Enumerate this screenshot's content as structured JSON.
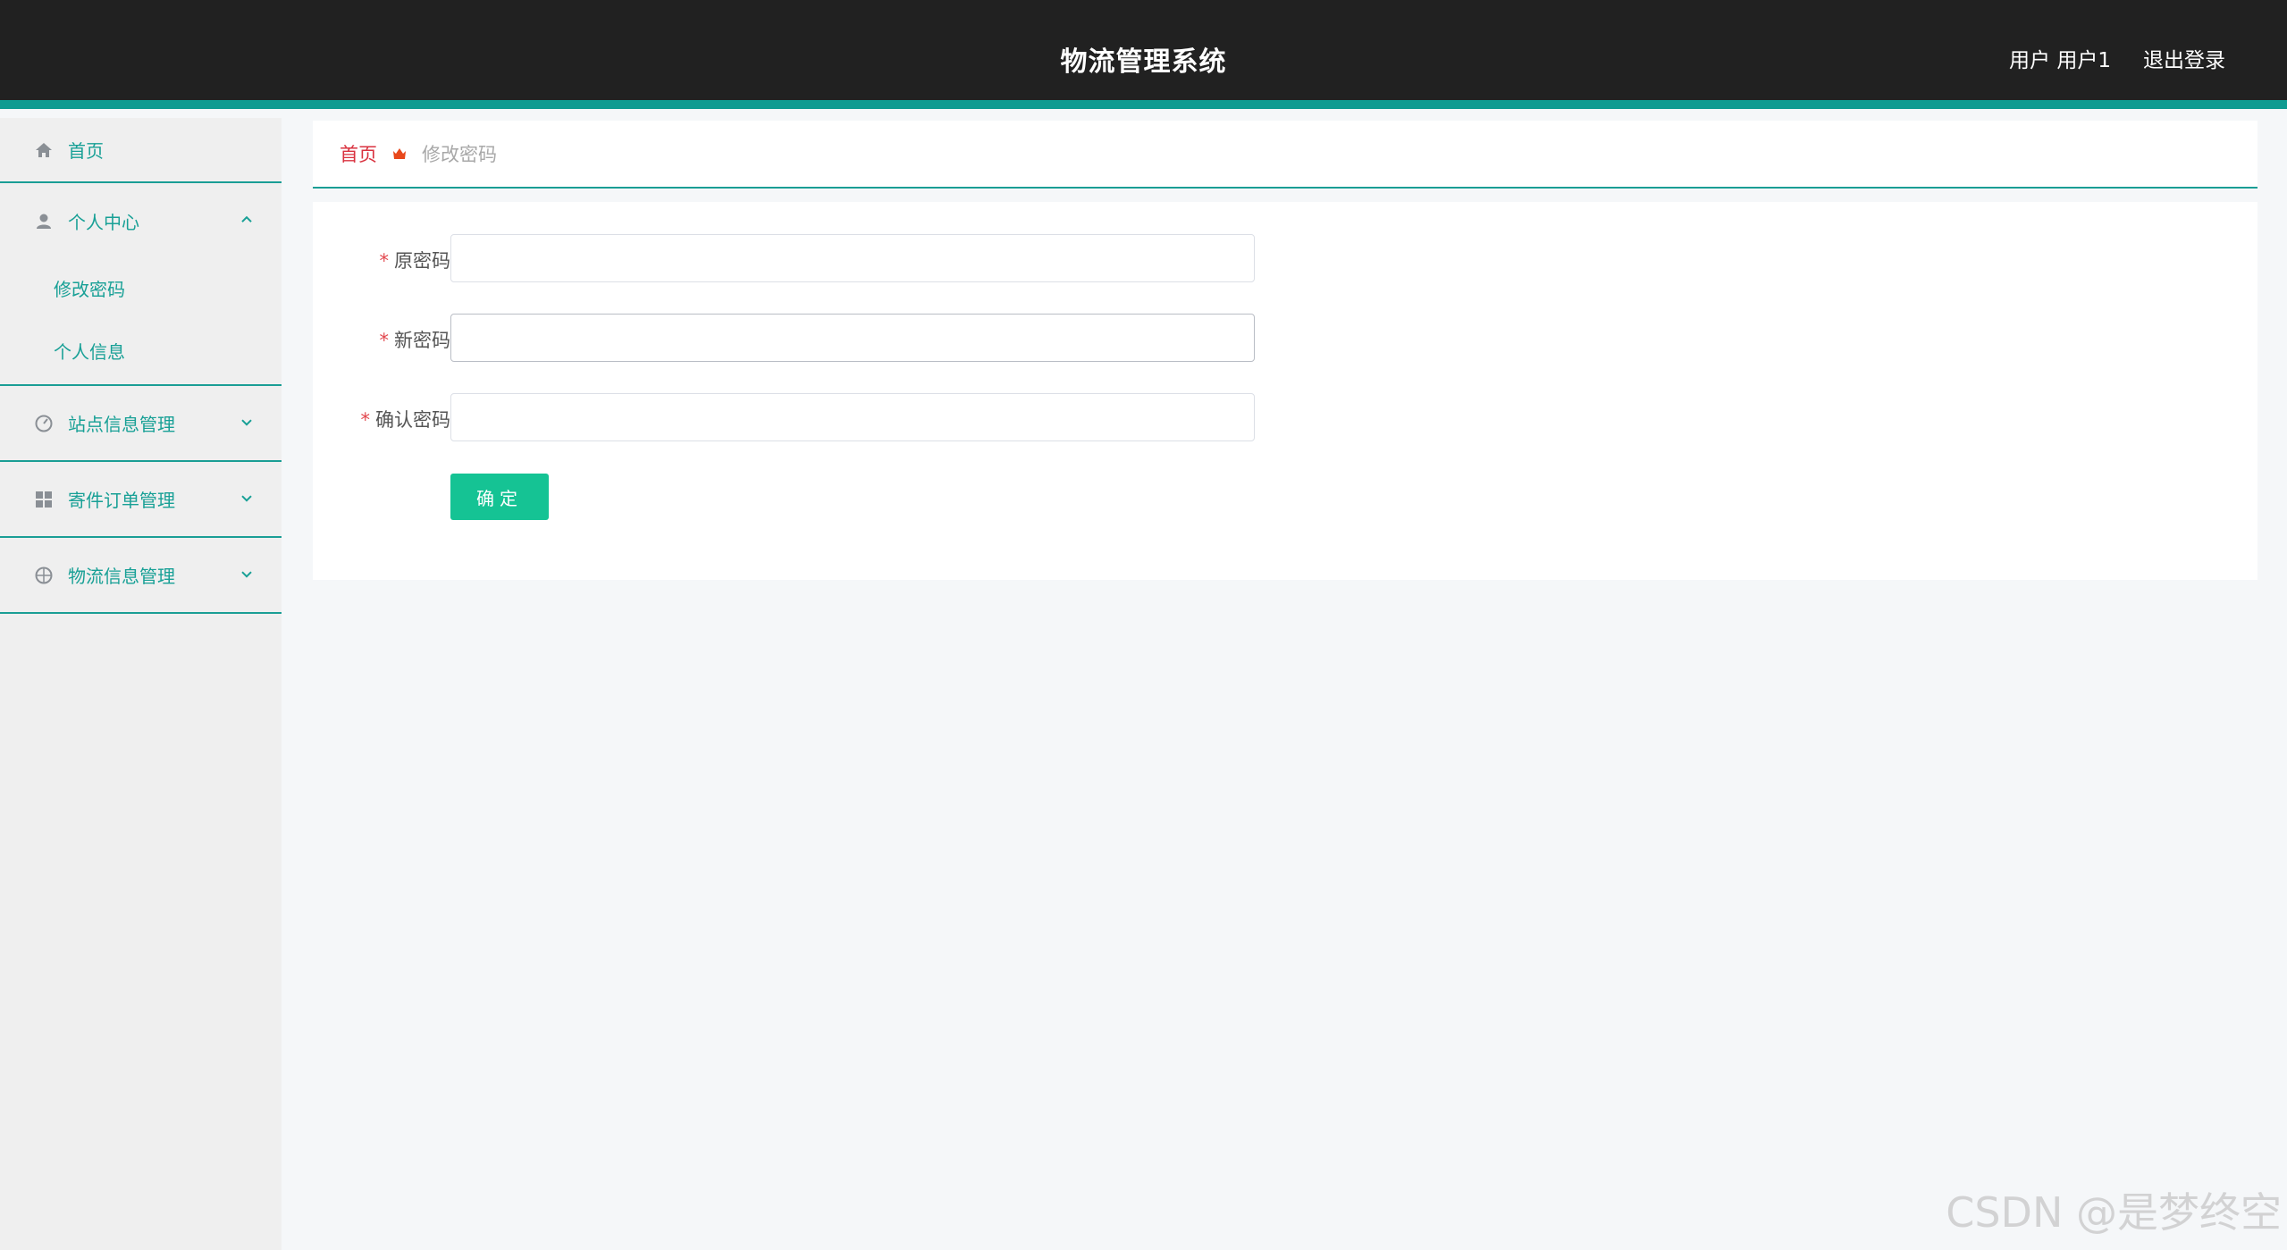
{
  "header": {
    "title": "物流管理系统",
    "user_label": "用户 用户1",
    "logout": "退出登录"
  },
  "sidebar": {
    "home": "首页",
    "personal_center": "个人中心",
    "change_password": "修改密码",
    "personal_info": "个人信息",
    "site_info": "站点信息管理",
    "order_mgmt": "寄件订单管理",
    "logistics_info": "物流信息管理"
  },
  "breadcrumb": {
    "home": "首页",
    "current": "修改密码"
  },
  "form": {
    "old_password_label": "原密码",
    "new_password_label": "新密码",
    "confirm_password_label": "确认密码",
    "required_mark": "*",
    "old_password_value": "",
    "new_password_value": "",
    "confirm_password_value": "",
    "submit": "确定"
  },
  "watermark": "CSDN @是梦终空",
  "colors": {
    "accent": "#0f9b91",
    "header_bg": "#212121",
    "button": "#15c394",
    "breadcrumb_home": "#d9323f"
  }
}
